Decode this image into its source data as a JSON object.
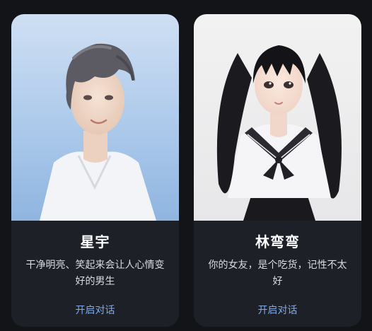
{
  "cards": [
    {
      "name": "星宇",
      "description": "干净明亮、笑起来会让人心情变好的男生",
      "cta_label": "开启对话",
      "image": "illustrated-portrait-young-man-white-shirt"
    },
    {
      "name": "林弯弯",
      "description": "你的女友，是个吃货，记性不太好",
      "cta_label": "开启对话",
      "image": "illustrated-portrait-girl-twin-tails-sailor-uniform"
    }
  ],
  "colors": {
    "background": "#121418",
    "card": "#1d2027",
    "name": "#ffffff",
    "description": "#d8dbe2",
    "cta": "#7fa9e8"
  }
}
